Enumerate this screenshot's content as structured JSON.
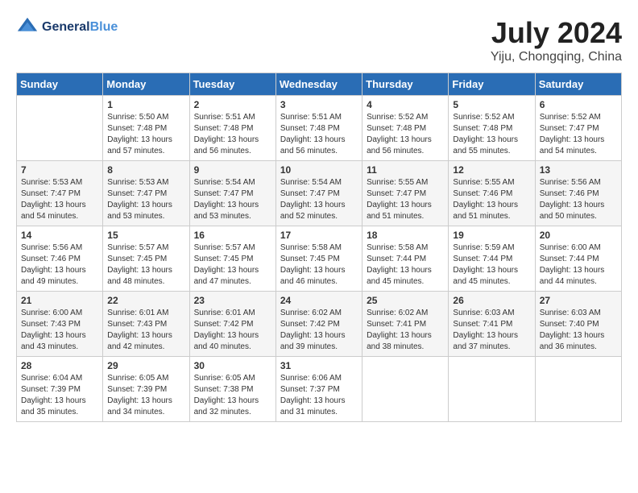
{
  "header": {
    "logo_line1": "General",
    "logo_line2": "Blue",
    "month": "July 2024",
    "location": "Yiju, Chongqing, China"
  },
  "weekdays": [
    "Sunday",
    "Monday",
    "Tuesday",
    "Wednesday",
    "Thursday",
    "Friday",
    "Saturday"
  ],
  "weeks": [
    [
      {
        "day": "",
        "info": ""
      },
      {
        "day": "1",
        "info": "Sunrise: 5:50 AM\nSunset: 7:48 PM\nDaylight: 13 hours\nand 57 minutes."
      },
      {
        "day": "2",
        "info": "Sunrise: 5:51 AM\nSunset: 7:48 PM\nDaylight: 13 hours\nand 56 minutes."
      },
      {
        "day": "3",
        "info": "Sunrise: 5:51 AM\nSunset: 7:48 PM\nDaylight: 13 hours\nand 56 minutes."
      },
      {
        "day": "4",
        "info": "Sunrise: 5:52 AM\nSunset: 7:48 PM\nDaylight: 13 hours\nand 56 minutes."
      },
      {
        "day": "5",
        "info": "Sunrise: 5:52 AM\nSunset: 7:48 PM\nDaylight: 13 hours\nand 55 minutes."
      },
      {
        "day": "6",
        "info": "Sunrise: 5:52 AM\nSunset: 7:47 PM\nDaylight: 13 hours\nand 54 minutes."
      }
    ],
    [
      {
        "day": "7",
        "info": "Sunrise: 5:53 AM\nSunset: 7:47 PM\nDaylight: 13 hours\nand 54 minutes."
      },
      {
        "day": "8",
        "info": "Sunrise: 5:53 AM\nSunset: 7:47 PM\nDaylight: 13 hours\nand 53 minutes."
      },
      {
        "day": "9",
        "info": "Sunrise: 5:54 AM\nSunset: 7:47 PM\nDaylight: 13 hours\nand 53 minutes."
      },
      {
        "day": "10",
        "info": "Sunrise: 5:54 AM\nSunset: 7:47 PM\nDaylight: 13 hours\nand 52 minutes."
      },
      {
        "day": "11",
        "info": "Sunrise: 5:55 AM\nSunset: 7:47 PM\nDaylight: 13 hours\nand 51 minutes."
      },
      {
        "day": "12",
        "info": "Sunrise: 5:55 AM\nSunset: 7:46 PM\nDaylight: 13 hours\nand 51 minutes."
      },
      {
        "day": "13",
        "info": "Sunrise: 5:56 AM\nSunset: 7:46 PM\nDaylight: 13 hours\nand 50 minutes."
      }
    ],
    [
      {
        "day": "14",
        "info": "Sunrise: 5:56 AM\nSunset: 7:46 PM\nDaylight: 13 hours\nand 49 minutes."
      },
      {
        "day": "15",
        "info": "Sunrise: 5:57 AM\nSunset: 7:45 PM\nDaylight: 13 hours\nand 48 minutes."
      },
      {
        "day": "16",
        "info": "Sunrise: 5:57 AM\nSunset: 7:45 PM\nDaylight: 13 hours\nand 47 minutes."
      },
      {
        "day": "17",
        "info": "Sunrise: 5:58 AM\nSunset: 7:45 PM\nDaylight: 13 hours\nand 46 minutes."
      },
      {
        "day": "18",
        "info": "Sunrise: 5:58 AM\nSunset: 7:44 PM\nDaylight: 13 hours\nand 45 minutes."
      },
      {
        "day": "19",
        "info": "Sunrise: 5:59 AM\nSunset: 7:44 PM\nDaylight: 13 hours\nand 45 minutes."
      },
      {
        "day": "20",
        "info": "Sunrise: 6:00 AM\nSunset: 7:44 PM\nDaylight: 13 hours\nand 44 minutes."
      }
    ],
    [
      {
        "day": "21",
        "info": "Sunrise: 6:00 AM\nSunset: 7:43 PM\nDaylight: 13 hours\nand 43 minutes."
      },
      {
        "day": "22",
        "info": "Sunrise: 6:01 AM\nSunset: 7:43 PM\nDaylight: 13 hours\nand 42 minutes."
      },
      {
        "day": "23",
        "info": "Sunrise: 6:01 AM\nSunset: 7:42 PM\nDaylight: 13 hours\nand 40 minutes."
      },
      {
        "day": "24",
        "info": "Sunrise: 6:02 AM\nSunset: 7:42 PM\nDaylight: 13 hours\nand 39 minutes."
      },
      {
        "day": "25",
        "info": "Sunrise: 6:02 AM\nSunset: 7:41 PM\nDaylight: 13 hours\nand 38 minutes."
      },
      {
        "day": "26",
        "info": "Sunrise: 6:03 AM\nSunset: 7:41 PM\nDaylight: 13 hours\nand 37 minutes."
      },
      {
        "day": "27",
        "info": "Sunrise: 6:03 AM\nSunset: 7:40 PM\nDaylight: 13 hours\nand 36 minutes."
      }
    ],
    [
      {
        "day": "28",
        "info": "Sunrise: 6:04 AM\nSunset: 7:39 PM\nDaylight: 13 hours\nand 35 minutes."
      },
      {
        "day": "29",
        "info": "Sunrise: 6:05 AM\nSunset: 7:39 PM\nDaylight: 13 hours\nand 34 minutes."
      },
      {
        "day": "30",
        "info": "Sunrise: 6:05 AM\nSunset: 7:38 PM\nDaylight: 13 hours\nand 32 minutes."
      },
      {
        "day": "31",
        "info": "Sunrise: 6:06 AM\nSunset: 7:37 PM\nDaylight: 13 hours\nand 31 minutes."
      },
      {
        "day": "",
        "info": ""
      },
      {
        "day": "",
        "info": ""
      },
      {
        "day": "",
        "info": ""
      }
    ]
  ]
}
